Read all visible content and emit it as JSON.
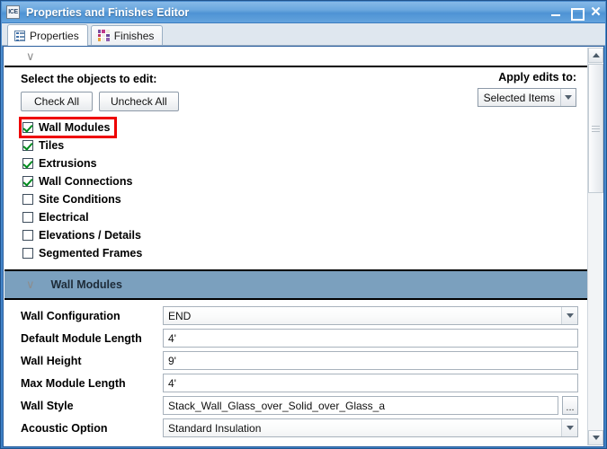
{
  "window": {
    "title": "Properties and Finishes Editor",
    "icon_label": "ICE",
    "icon_name": "app-icon",
    "controls": {
      "minimize": "minimize-icon",
      "maximize": "maximize-icon",
      "close": "✕"
    }
  },
  "tabs": [
    {
      "label": "Properties",
      "icon": "list-icon",
      "active": true
    },
    {
      "label": "Finishes",
      "icon": "color-grid-icon",
      "active": false
    }
  ],
  "collapse_bar": {
    "chevron": "∨",
    "icon_name": "chevron-down-icon"
  },
  "selection": {
    "heading": "Select the objects to edit:",
    "check_all_label": "Check All",
    "uncheck_all_label": "Uncheck All",
    "apply_label": "Apply edits to:",
    "apply_value": "Selected Items",
    "objects": [
      {
        "label": "Wall Modules",
        "checked": true,
        "highlighted": true
      },
      {
        "label": "Tiles",
        "checked": true,
        "highlighted": false
      },
      {
        "label": "Extrusions",
        "checked": true,
        "highlighted": false
      },
      {
        "label": "Wall Connections",
        "checked": true,
        "highlighted": false
      },
      {
        "label": "Site Conditions",
        "checked": false,
        "highlighted": false
      },
      {
        "label": "Electrical",
        "checked": false,
        "highlighted": false
      },
      {
        "label": "Elevations / Details",
        "checked": false,
        "highlighted": false
      },
      {
        "label": "Segmented Frames",
        "checked": false,
        "highlighted": false
      }
    ]
  },
  "section": {
    "title": "Wall Modules",
    "chevron": "∨",
    "background_color": "#7ba0be"
  },
  "properties": [
    {
      "name": "Wall Configuration",
      "value": "END",
      "control": "dropdown"
    },
    {
      "name": "Default Module Length",
      "value": "4'",
      "control": "text"
    },
    {
      "name": "Wall Height",
      "value": "9'",
      "control": "text"
    },
    {
      "name": "Max Module Length",
      "value": "4'",
      "control": "text"
    },
    {
      "name": "Wall Style",
      "value": "Stack_Wall_Glass_over_Solid_over_Glass_a",
      "control": "text-browse",
      "browse_label": "..."
    },
    {
      "name": "Acoustic Option",
      "value": "Standard Insulation",
      "control": "dropdown"
    }
  ],
  "scrollbar": {
    "up_icon": "scroll-up-arrow-icon",
    "down_icon": "scroll-down-arrow-icon",
    "thumb": "scrollbar-thumb"
  },
  "colors": {
    "titlebar_blue": "#4e93d4",
    "section_blue": "#7ba0be",
    "highlight_red": "#ee0000",
    "check_green": "#008b1e"
  },
  "finishes_icon_colors": [
    "#7a4fa0",
    "#c03a8a",
    "#efeadc",
    "#b8336a",
    "#f0eee6",
    "#6a4a9a",
    "#e8a33d",
    "#f2f0e8",
    "#8f5fae"
  ]
}
